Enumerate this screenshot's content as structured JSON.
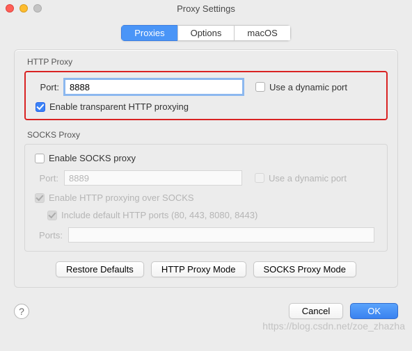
{
  "window": {
    "title": "Proxy Settings"
  },
  "tabs": {
    "proxies": "Proxies",
    "options": "Options",
    "macos": "macOS"
  },
  "http": {
    "group_label": "HTTP Proxy",
    "port_label": "Port:",
    "port_value": "8888",
    "dynamic_label": "Use a dynamic port",
    "dynamic_checked": false,
    "transparent_label": "Enable transparent HTTP proxying",
    "transparent_checked": true
  },
  "socks": {
    "group_label": "SOCKS Proxy",
    "enable_label": "Enable SOCKS proxy",
    "enable_checked": false,
    "port_label": "Port:",
    "port_value": "8889",
    "dynamic_label": "Use a dynamic port",
    "dynamic_checked": false,
    "http_over_label": "Enable HTTP proxying over SOCKS",
    "http_over_checked": true,
    "include_label": "Include default HTTP ports (80, 443, 8080, 8443)",
    "include_checked": true,
    "ports_label": "Ports:",
    "ports_value": ""
  },
  "buttons": {
    "restore": "Restore Defaults",
    "http_mode": "HTTP Proxy Mode",
    "socks_mode": "SOCKS Proxy Mode",
    "cancel": "Cancel",
    "ok": "OK",
    "help": "?"
  },
  "watermark": "https://blog.csdn.net/zoe_zhazha"
}
